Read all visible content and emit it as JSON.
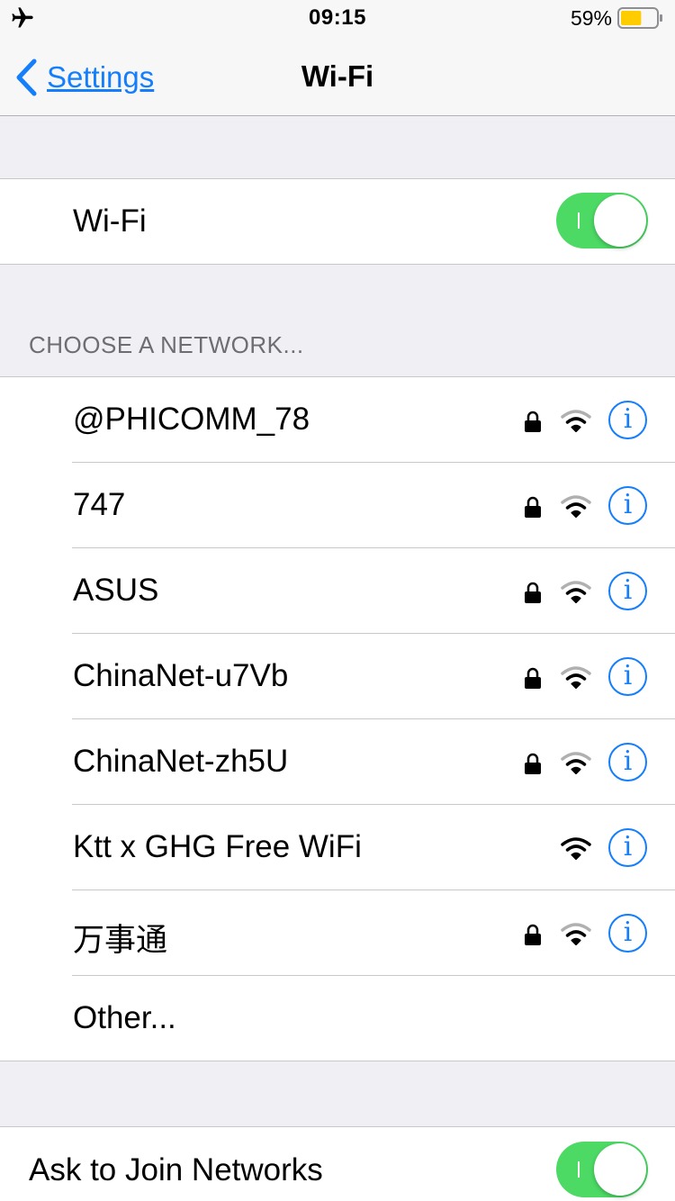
{
  "status_bar": {
    "airplane_icon": "airplane-icon",
    "time": "09:15",
    "battery_percent": "59%",
    "battery_level": 0.59,
    "battery_color": "#ffcc00"
  },
  "nav": {
    "back_label": "Settings",
    "title": "Wi-Fi"
  },
  "wifi_toggle": {
    "label": "Wi-Fi",
    "on": true
  },
  "networks_section": {
    "header": "CHOOSE A NETWORK..."
  },
  "networks": [
    {
      "name": "@PHICOMM_78",
      "locked": true
    },
    {
      "name": "747",
      "locked": true
    },
    {
      "name": "ASUS",
      "locked": true
    },
    {
      "name": "ChinaNet-u7Vb",
      "locked": true
    },
    {
      "name": "ChinaNet-zh5U",
      "locked": true
    },
    {
      "name": "Ktt x GHG Free WiFi",
      "locked": false
    },
    {
      "name": "万事通",
      "locked": true
    }
  ],
  "other": {
    "label": "Other..."
  },
  "ask_to_join": {
    "label": "Ask to Join Networks",
    "on": true
  },
  "colors": {
    "accent": "#147efb",
    "toggle_on": "#4cd964",
    "background": "#efeff4"
  }
}
